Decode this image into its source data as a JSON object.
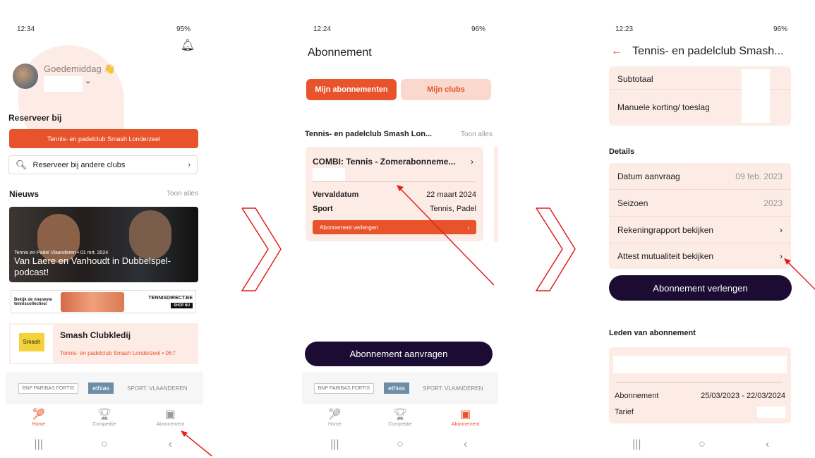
{
  "phone1": {
    "status_time": "12:34",
    "status_right": "95%",
    "greeting": "Goedemiddag 👋",
    "reserveer_heading": "Reserveer bij",
    "club_button": "Tennis- en padelclub Smash Londerzeel",
    "search_label": "Reserveer bij andere clubs",
    "nieuws_heading": "Nieuws",
    "toon_alles": "Toon alles",
    "news_meta": "Tennis en Padel Vlaanderen • 01 mrt. 2024",
    "news_title": "Van Laere en Vanhoudt in Dubbelspel-podcast!",
    "banner_left": "Bekijk de nieuwste tenniscollecties!",
    "banner_brand": "TENNISDIRECT.BE",
    "banner_shop": "SHOP NU",
    "clubcard_title": "Smash Clubkledij",
    "clubcard_logo": "Smash",
    "clubcard_sub": "Tennis- en padelclub Smash Londerzeel • 06 f",
    "nav": [
      "Home",
      "Competitie",
      "Abonnement"
    ]
  },
  "phone2": {
    "status_time": "12:24",
    "status_right": "96%",
    "title": "Abonnement",
    "seg_on": "Mijn abonnementen",
    "seg_off": "Mijn clubs",
    "club_heading": "Tennis- en padelclub Smash Lon...",
    "toon_alles": "Toon alles",
    "sub_name": "COMBI: Tennis - Zomerabonneme...",
    "vervaldatum_label": "Vervaldatum",
    "vervaldatum_value": "22 maart 2024",
    "sport_label": "Sport",
    "sport_value": "Tennis, Padel",
    "extend_label": "Abonnement verlengen",
    "request_button": "Abonnement aanvragen",
    "nav": [
      "Home",
      "Competitie",
      "Abonnement"
    ]
  },
  "phone3": {
    "status_time": "12:23",
    "status_right": "96%",
    "title": "Tennis- en padelclub Smash...",
    "subtotaal": "Subtotaal",
    "manuele": "Manuele korting/ toeslag",
    "details_heading": "Details",
    "datum_label": "Datum aanvraag",
    "datum_value": "09 feb. 2023",
    "seizoen_label": "Seizoen",
    "seizoen_value": "2023",
    "rekening_label": "Rekeningrapport bekijken",
    "attest_label": "Attest mutualiteit bekijken",
    "extend_button": "Abonnement verlengen",
    "leden_heading": "Leden van abonnement",
    "abonnement_label": "Abonnement",
    "abonnement_value": "25/03/2023 - 22/03/2024",
    "tarief_label": "Tarief"
  },
  "sponsors": [
    "BNP PARIBAS FORTIS",
    "ethias",
    "SPORT. VLAANDEREN"
  ],
  "colors": {
    "accent": "#e8532c",
    "dark": "#1c0c33",
    "card": "#fdece6",
    "annotation": "#e02020"
  }
}
